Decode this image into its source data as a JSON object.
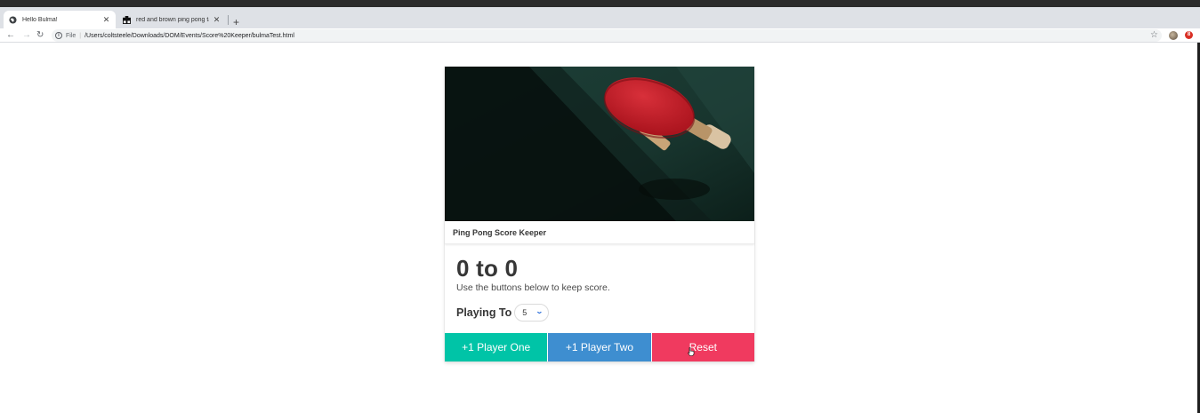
{
  "browser": {
    "tabs": [
      {
        "title": "Hello Bulma!",
        "active": true
      },
      {
        "title": "red and brown ping pong table",
        "active": false
      }
    ],
    "new_tab": "+",
    "address": {
      "scheme": "File",
      "path": "/Users/coltsteele/Downloads/DOM/Events/Score%20Keeper/bulmaTest.html"
    },
    "extension_badge": "8"
  },
  "card": {
    "header_title": "Ping Pong Score Keeper",
    "score": "0 to 0",
    "help_text": "Use the buttons below to keep score.",
    "playing_to_label": "Playing To",
    "playing_to_value": "5",
    "buttons": {
      "player_one": "+1 Player One",
      "player_two": "+1 Player Two",
      "reset": "Reset"
    }
  },
  "colors": {
    "player_one": "#00c4a7",
    "player_two": "#3e8ed0",
    "reset": "#f03a5f"
  },
  "icons": [
    "globe-icon",
    "close-icon",
    "image-icon",
    "plus-icon",
    "back-arrow-icon",
    "forward-arrow-icon",
    "reload-icon",
    "info-icon",
    "star-icon",
    "profile-avatar-icon",
    "extension-badge-icon",
    "chevron-down-icon",
    "hand-cursor-icon"
  ]
}
